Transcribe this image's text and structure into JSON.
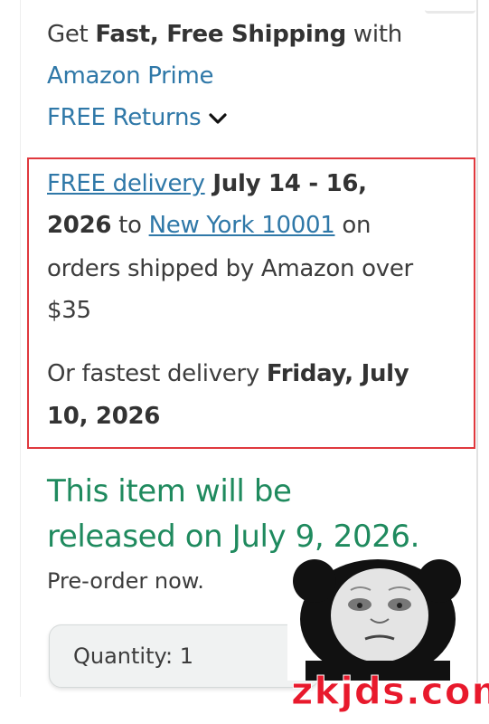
{
  "shipping": {
    "get_text": "Get ",
    "fast_free": "Fast, Free Shipping",
    "with_text": " with",
    "prime_link": "Amazon Prime",
    "free_returns": "FREE Returns"
  },
  "delivery": {
    "free_delivery_link": "FREE delivery",
    "date_range_part1": " July 14 - 16,",
    "date_range_part2": "2026",
    "to_text": " to ",
    "location_link": "New York 10001",
    "on_text": " on",
    "condition_line": "orders shipped by Amazon over",
    "threshold": "$35",
    "fastest_prefix": "Or fastest delivery ",
    "fastest_date_part1": "Friday, July",
    "fastest_date_part2": "10, 2026"
  },
  "release": {
    "line1": "This item will be",
    "line2": "released on July 9, 2026.",
    "preorder": "Pre-order now."
  },
  "quantity": {
    "label": "Quantity:",
    "value": "1"
  },
  "watermark": {
    "text": "zkjds.com"
  },
  "colors": {
    "link_blue": "#2f78a8",
    "release_green": "#1f8a5e",
    "highlight_box": "#e0393e",
    "watermark_red": "#e8192c"
  },
  "icons": {
    "returns_toggle": "chevron-down-icon",
    "meme_sticker": "panda-meme-icon"
  }
}
